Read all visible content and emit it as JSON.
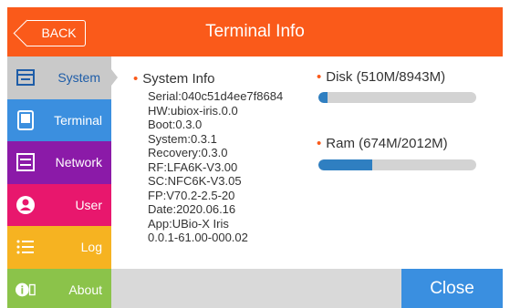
{
  "header": {
    "back_label": "BACK",
    "title": "Terminal Info"
  },
  "sidebar": {
    "items": [
      {
        "label": "System",
        "icon": "system-icon",
        "color": "#c9c9c9",
        "active": true
      },
      {
        "label": "Terminal",
        "icon": "terminal-icon",
        "color": "#3b8fdf",
        "active": false
      },
      {
        "label": "Network",
        "icon": "network-icon",
        "color": "#8b1aa8",
        "active": false
      },
      {
        "label": "User",
        "icon": "user-icon",
        "color": "#e8176d",
        "active": false
      },
      {
        "label": "Log",
        "icon": "log-icon",
        "color": "#f6b321",
        "active": false
      },
      {
        "label": "About",
        "icon": "info-icon",
        "color": "#8bc34a",
        "active": false
      }
    ]
  },
  "system_info": {
    "title": "System Info",
    "lines": [
      "Serial:040c51d4ee7f8684",
      "HW:ubiox-iris.0.0",
      "Boot:0.3.0",
      "System:0.3.1",
      "Recovery:0.3.0",
      "RF:LFA6K-V3.00",
      "SC:NFC6K-V3.05",
      "FP:V70.2-2.5-20",
      "Date:2020.06.16",
      "App:UBio-X Iris",
      "0.0.1-61.00-000.02"
    ]
  },
  "disk": {
    "title": "Disk (510M/8943M)",
    "used_fraction": 0.057
  },
  "ram": {
    "title": "Ram (674M/2012M)",
    "used_fraction": 0.335
  },
  "footer": {
    "close_label": "Close"
  },
  "colors": {
    "header": "#fa5a1a",
    "accent": "#2f7fc1",
    "close": "#3a8fe0"
  }
}
